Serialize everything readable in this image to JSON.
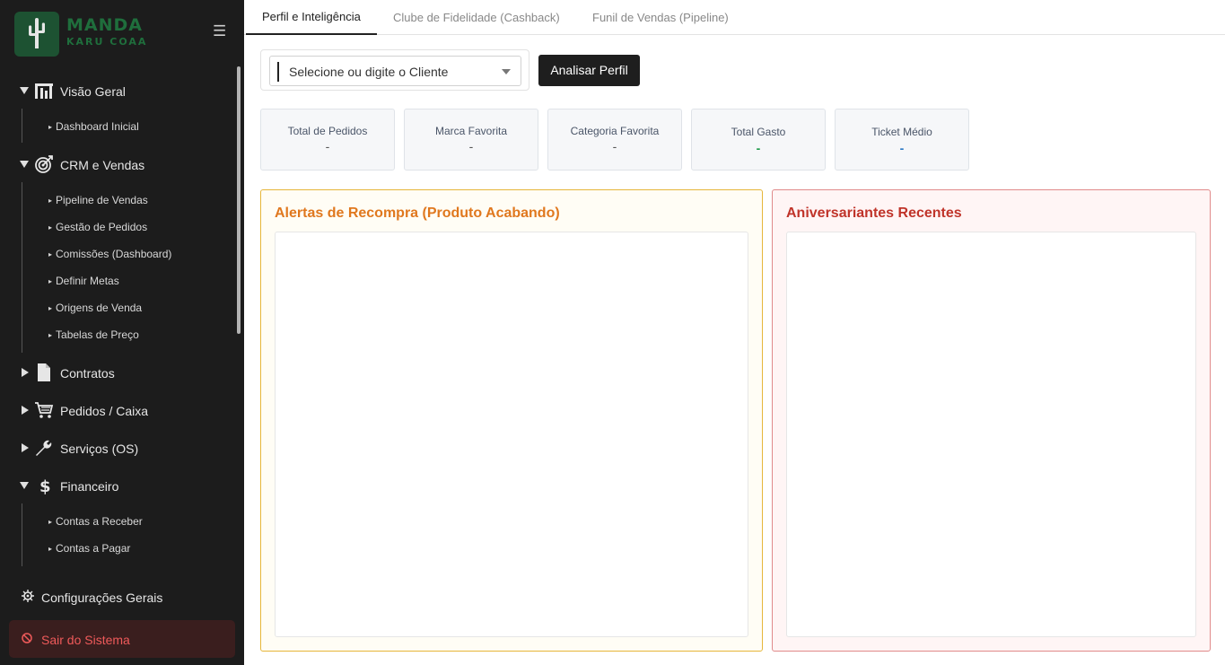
{
  "brand": {
    "line1": "MANDA",
    "line2": "KARU COAA"
  },
  "sidebar": {
    "groups": [
      {
        "label": "Visão Geral",
        "icon": "dashboard-bars-icon",
        "expanded": true,
        "items": [
          {
            "label": "Dashboard Inicial"
          }
        ]
      },
      {
        "label": "CRM e Vendas",
        "icon": "target-icon",
        "expanded": true,
        "items": [
          {
            "label": "Pipeline de Vendas"
          },
          {
            "label": "Gestão de Pedidos"
          },
          {
            "label": "Comissões (Dashboard)"
          },
          {
            "label": "Definir Metas"
          },
          {
            "label": "Origens de Venda"
          },
          {
            "label": "Tabelas de Preço"
          }
        ]
      },
      {
        "label": "Contratos",
        "icon": "document-icon",
        "expanded": false
      },
      {
        "label": "Pedidos / Caixa",
        "icon": "cart-icon",
        "expanded": false
      },
      {
        "label": "Serviços (OS)",
        "icon": "wrench-icon",
        "expanded": false
      },
      {
        "label": "Financeiro",
        "icon": "dollar-icon",
        "expanded": true,
        "items": [
          {
            "label": "Contas a Receber"
          },
          {
            "label": "Contas a Pagar"
          }
        ]
      }
    ],
    "settings_label": "Configurações Gerais",
    "logout_label": "Sair do Sistema"
  },
  "tabs": [
    {
      "label": "Perfil e Inteligência",
      "active": true
    },
    {
      "label": "Clube de Fidelidade (Cashback)",
      "active": false
    },
    {
      "label": "Funil de Vendas (Pipeline)",
      "active": false
    }
  ],
  "search": {
    "placeholder": "Selecione ou digite o Cliente",
    "button_label": "Analisar Perfil"
  },
  "stats": [
    {
      "label": "Total de Pedidos",
      "value": "-"
    },
    {
      "label": "Marca Favorita",
      "value": "-"
    },
    {
      "label": "Categoria Favorita",
      "value": "-"
    },
    {
      "label": "Total Gasto",
      "value": "-"
    },
    {
      "label": "Ticket Médio",
      "value": "-"
    }
  ],
  "panels": {
    "rebuy": {
      "title": "Alertas de Recompra (Produto Acabando)"
    },
    "birthdays": {
      "title": "Aniversariantes Recentes"
    }
  },
  "colors": {
    "sidebar_bg": "#1c1c1c",
    "brand_green": "#1d5232",
    "rebuy_accent": "#e0781e",
    "birthday_accent": "#c0342a",
    "total_spent": "#1f9a4a",
    "avg_ticket": "#2b78c4",
    "logout": "#ef5a5a"
  }
}
